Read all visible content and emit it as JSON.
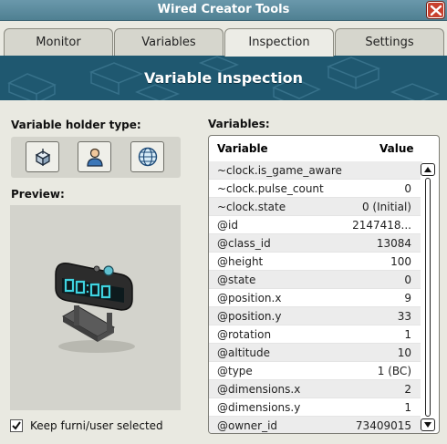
{
  "window": {
    "title": "Wired Creator Tools"
  },
  "tabs": [
    {
      "label": "Monitor"
    },
    {
      "label": "Variables"
    },
    {
      "label": "Inspection"
    },
    {
      "label": "Settings"
    }
  ],
  "active_tab": "Inspection",
  "banner": {
    "title": "Variable Inspection"
  },
  "holder": {
    "label": "Variable holder type:",
    "buttons": [
      "furni-icon",
      "user-icon",
      "global-icon"
    ]
  },
  "preview": {
    "label": "Preview:"
  },
  "keep_selected": {
    "label": "Keep furni/user selected",
    "checked": true
  },
  "variables": {
    "label": "Variables:",
    "col_variable": "Variable",
    "col_value": "Value",
    "rows": [
      {
        "name": "~clock.is_game_aware",
        "value": ""
      },
      {
        "name": "~clock.pulse_count",
        "value": "0"
      },
      {
        "name": "~clock.state",
        "value": "0 (Initial)"
      },
      {
        "name": "@id",
        "value": "2147418..."
      },
      {
        "name": "@class_id",
        "value": "13084"
      },
      {
        "name": "@height",
        "value": "100"
      },
      {
        "name": "@state",
        "value": "0"
      },
      {
        "name": "@position.x",
        "value": "9"
      },
      {
        "name": "@position.y",
        "value": "33"
      },
      {
        "name": "@rotation",
        "value": "1"
      },
      {
        "name": "@altitude",
        "value": "10"
      },
      {
        "name": "@type",
        "value": "1 (BC)"
      },
      {
        "name": "@dimensions.x",
        "value": "2"
      },
      {
        "name": "@dimensions.y",
        "value": "1"
      },
      {
        "name": "@owner_id",
        "value": "73409015"
      }
    ]
  },
  "colors": {
    "titlebar": "#5b8a9c",
    "banner": "#1f5870",
    "close": "#c8402e",
    "clock_digits": "#3fd3e0"
  }
}
